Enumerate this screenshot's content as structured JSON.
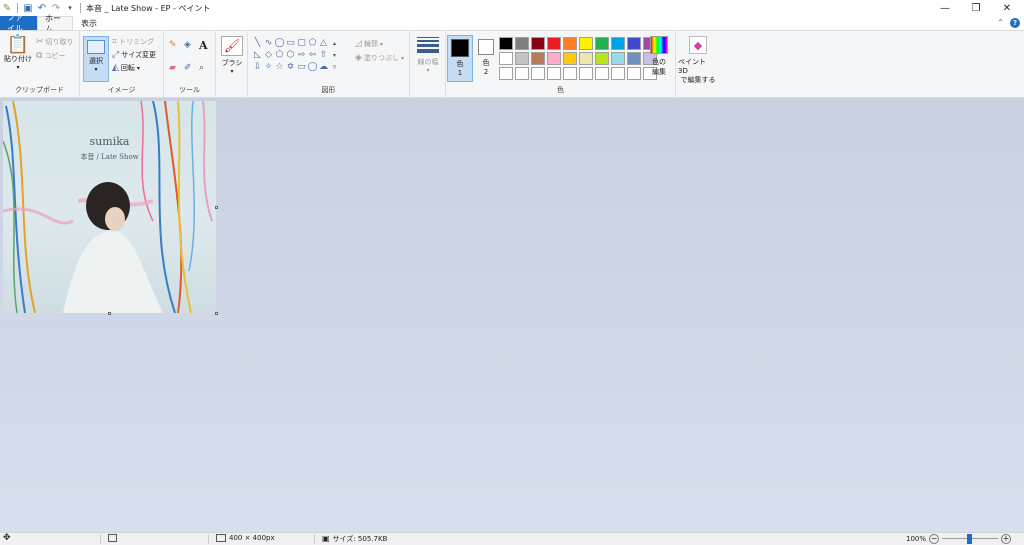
{
  "window": {
    "title": "本音 _ Late Show - EP - ペイント",
    "quick_access_menu": "▾"
  },
  "tabs": {
    "file": "ファイル",
    "home": "ホーム",
    "view": "表示"
  },
  "ribbon": {
    "clipboard": {
      "label": "クリップボード",
      "paste": "貼り付け",
      "cut": "切り取り",
      "copy": "コピー"
    },
    "image": {
      "label": "イメージ",
      "select": "選択",
      "crop": "トリミング",
      "resize": "サイズ変更",
      "rotate": "回転"
    },
    "tools": {
      "label": "ツール"
    },
    "brushes": {
      "label": "ブラシ"
    },
    "shapes": {
      "label": "図形",
      "outline": "輪郭",
      "fill": "塗りつぶし"
    },
    "size": {
      "label": "線の幅"
    },
    "colors": {
      "label": "色",
      "color1": "色",
      "color1_num": "1",
      "color2": "色",
      "color2_num": "2",
      "edit_colors_1": "色の",
      "edit_colors_2": "編集",
      "paint3d_1": "ペイント 3D",
      "paint3d_2": "で編集する",
      "color1_value": "#000000",
      "color2_value": "#ffffff",
      "palette": [
        "#000000",
        "#7f7f7f",
        "#880015",
        "#ed1c24",
        "#ff7f27",
        "#fff200",
        "#22b14c",
        "#00a2e8",
        "#3f48cc",
        "#a349a4",
        "#ffffff",
        "#c3c3c3",
        "#b97a57",
        "#ffaec9",
        "#ffc90e",
        "#efe4b0",
        "#b5e61d",
        "#99d9ea",
        "#7092be",
        "#c8bfe7",
        "#ffffff",
        "#ffffff",
        "#ffffff",
        "#ffffff",
        "#ffffff",
        "#ffffff",
        "#ffffff",
        "#ffffff",
        "#ffffff",
        "#ffffff"
      ]
    }
  },
  "canvas_image": {
    "artist": "sumika",
    "album": "本音 / Late Show"
  },
  "status": {
    "dimensions": "400 × 400px",
    "size": "サイズ: 505.7KB",
    "zoom": "100%"
  }
}
